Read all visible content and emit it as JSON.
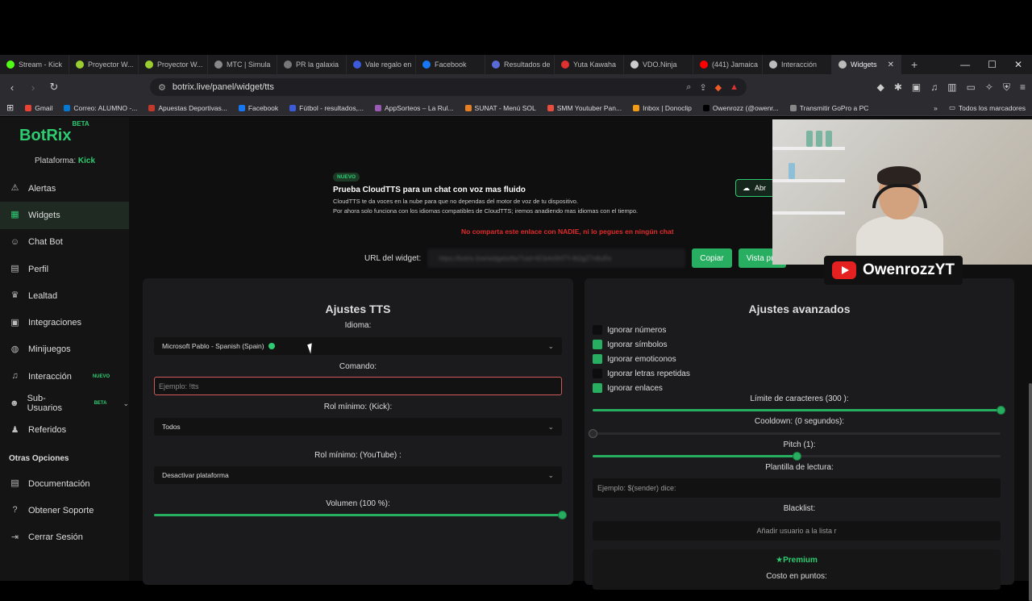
{
  "tabs": [
    {
      "title": "Stream - Kick",
      "color": "#53fc18"
    },
    {
      "title": "Proyector W...",
      "color": "#9acd32"
    },
    {
      "title": "Proyector W...",
      "color": "#9acd32"
    },
    {
      "title": "MTC | Simula",
      "color": "#888888"
    },
    {
      "title": "PR la galaxia",
      "color": "#777777"
    },
    {
      "title": "Vale regalo en",
      "color": "#3b5bdb"
    },
    {
      "title": "Facebook",
      "color": "#1877f2"
    },
    {
      "title": "Resultados de",
      "color": "#5b6bd6"
    },
    {
      "title": "Yuta Kawaha",
      "color": "#e03131"
    },
    {
      "title": "VDO.Ninja",
      "color": "#cccccc"
    },
    {
      "title": "(441) Jamaica",
      "color": "#ff0000"
    },
    {
      "title": "Interacción",
      "color": "#bbbbbb"
    },
    {
      "title": "Widgets",
      "color": "#bbbbbb",
      "active": true
    }
  ],
  "address": {
    "url": "botrix.live/panel/widget/tts"
  },
  "bookmarks": [
    {
      "label": "Gmail",
      "color": "#ea4335"
    },
    {
      "label": "Correo: ALUMNO -...",
      "color": "#0078d4"
    },
    {
      "label": "Apuestas Deportivas...",
      "color": "#c0392b"
    },
    {
      "label": "Facebook",
      "color": "#1877f2"
    },
    {
      "label": "Fútbol - resultados,...",
      "color": "#3b5bdb"
    },
    {
      "label": "AppSorteos – La Rul...",
      "color": "#9b59b6"
    },
    {
      "label": "SUNAT - Menú SOL",
      "color": "#e67e22"
    },
    {
      "label": "SMM Youtuber Pan...",
      "color": "#e74c3c"
    },
    {
      "label": "Inbox | Donoclip",
      "color": "#f39c12"
    },
    {
      "label": "Owenrozz (@owenr...",
      "color": "#000000"
    },
    {
      "label": "Transmitir GoPro a PC",
      "color": "#888888"
    }
  ],
  "bookmarks_all": "Todos los marcadores",
  "app": {
    "logo": "BotRix",
    "logo_badge": "BETA",
    "platform_label": "Plataforma:",
    "platform_value": "Kick"
  },
  "sidebar": {
    "items": [
      {
        "label": "Alertas",
        "icon": "⚠"
      },
      {
        "label": "Widgets",
        "icon": "▦",
        "active": true
      },
      {
        "label": "Chat Bot",
        "icon": "☺"
      },
      {
        "label": "Perfil",
        "icon": "▤"
      },
      {
        "label": "Lealtad",
        "icon": "♛"
      },
      {
        "label": "Integraciones",
        "icon": "▣"
      },
      {
        "label": "Minijuegos",
        "icon": "◍"
      },
      {
        "label": "Interacción",
        "icon": "♫",
        "tag": "NUEVO"
      },
      {
        "label": "Sub-Usuarios",
        "icon": "☻",
        "tag": "BETA",
        "chevron": "⌄"
      },
      {
        "label": "Referidos",
        "icon": "♟"
      }
    ],
    "other_heading": "Otras Opciones",
    "other_items": [
      {
        "label": "Documentación",
        "icon": "▤"
      },
      {
        "label": "Obtener Soporte",
        "icon": "?"
      },
      {
        "label": "Cerrar Sesión",
        "icon": "⇥"
      }
    ]
  },
  "promo": {
    "badge": "NUEVO",
    "title": "Prueba CloudTTS para un chat con voz mas fluido",
    "line1": "CloudTTS te da voces en la nube para que no dependas del motor de voz de tu dispositivo.",
    "line2": "Por ahora solo funciona con los idiomas compatibles de CloudTTS; iremos anadiendo mas idiomas con el tiempo.",
    "button": "Abr"
  },
  "warning": "No comparta este enlace con NADIE, ni lo pegues en ningún chat",
  "widget_url": {
    "label": "URL del widget:",
    "value": "https://botrix.live/widgets/tts/?uid=6Cb4x0hf7Y-8t2gZ7n8uRe",
    "copy": "Copiar",
    "preview": "Vista pre"
  },
  "tts": {
    "title": "Ajustes TTS",
    "idioma_label": "Idioma:",
    "idioma_value": "Microsoft Pablo - Spanish (Spain)",
    "comando_label": "Comando:",
    "comando_placeholder": "Ejemplo: !tts",
    "rol_kick_label": "Rol mínimo: (Kick):",
    "rol_kick_value": "Todos",
    "rol_yt_label": "Rol mínimo: (YouTube) :",
    "rol_yt_value": "Desactivar plataforma",
    "volumen_label": "Volumen (100 %):",
    "volumen": 1.0
  },
  "advanced": {
    "title": "Ajustes avanzados",
    "checkboxes": [
      {
        "label": "Ignorar números",
        "checked": false
      },
      {
        "label": "Ignorar símbolos",
        "checked": true
      },
      {
        "label": "Ignorar emoticonos",
        "checked": true
      },
      {
        "label": "Ignorar letras repetidas",
        "checked": false
      },
      {
        "label": "Ignorar enlaces",
        "checked": true
      }
    ],
    "limite_label": "Límite de caracteres (300 ):",
    "limite": 1.0,
    "cooldown_label": "Cooldown: (0 segundos):",
    "cooldown": 0.0,
    "pitch_label": "Pitch (1):",
    "pitch": 0.5,
    "plantilla_label": "Plantilla de lectura:",
    "plantilla_placeholder": "Ejemplo: $(sender) dice:",
    "blacklist_label": "Blacklist:",
    "blacklist_placeholder": "Añadir usuario a la lista r",
    "premium": "Premium",
    "costo_label": "Costo en puntos:"
  },
  "overlay": {
    "channel": "OwenrozzYT"
  },
  "colors": {
    "accent": "#27ae60",
    "warning": "#e02b2b"
  }
}
